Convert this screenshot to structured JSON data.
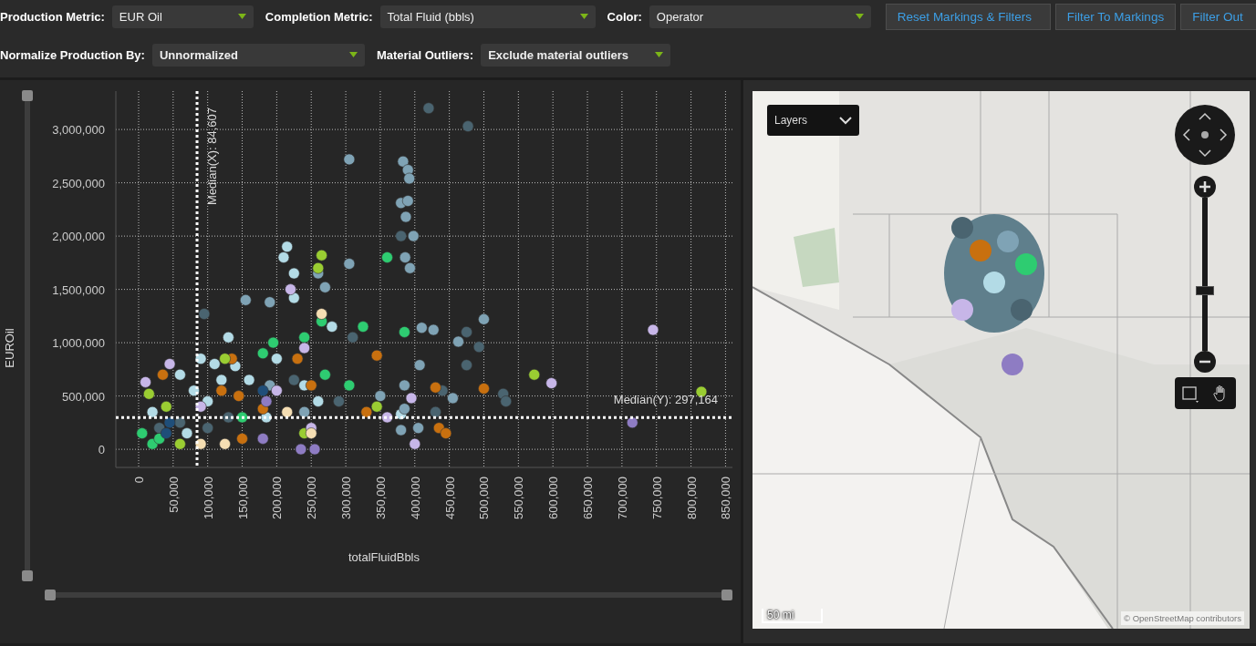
{
  "filter_row_1": [
    {
      "label": "Production Metric:",
      "value": "EUR Oil",
      "bold": false
    },
    {
      "label": "Completion Metric:",
      "value": "Total Fluid (bbls)",
      "bold": false
    },
    {
      "label": "Color:",
      "value": "Operator",
      "bold": false
    }
  ],
  "buttons": [
    "Reset Markings & Filters",
    "Filter To Markings",
    "Filter Out"
  ],
  "filter_row_2": [
    {
      "label": "Normalize Production By:",
      "value": "Unnormalized",
      "bold": true
    },
    {
      "label": "Material Outliers:",
      "value": "Exclude material outliers",
      "bold": true
    }
  ],
  "chart_panel": {
    "chart_data": {
      "type": "scatter",
      "xlabel": "totalFluidBbls",
      "ylabel": "EUROil",
      "grid": true,
      "xlim": [
        -33000,
        860000
      ],
      "ylim": [
        -170000,
        3360000
      ],
      "xticks": [
        {
          "value": 0,
          "label": "0"
        },
        {
          "value": 50000,
          "label": "50,000"
        },
        {
          "value": 100000,
          "label": "100,000"
        },
        {
          "value": 150000,
          "label": "150,000"
        },
        {
          "value": 200000,
          "label": "200,000"
        },
        {
          "value": 250000,
          "label": "250,000"
        },
        {
          "value": 300000,
          "label": "300,000"
        },
        {
          "value": 350000,
          "label": "350,000"
        },
        {
          "value": 400000,
          "label": "400,000"
        },
        {
          "value": 450000,
          "label": "450,000"
        },
        {
          "value": 500000,
          "label": "500,000"
        },
        {
          "value": 550000,
          "label": "550,000"
        },
        {
          "value": 600000,
          "label": "600,000"
        },
        {
          "value": 650000,
          "label": "650,000"
        },
        {
          "value": 700000,
          "label": "700,000"
        },
        {
          "value": 750000,
          "label": "750,000"
        },
        {
          "value": 800000,
          "label": "800,000"
        },
        {
          "value": 850000,
          "label": "850,000"
        }
      ],
      "yticks": [
        {
          "value": 0,
          "label": "0"
        },
        {
          "value": 500000,
          "label": "500,000"
        },
        {
          "value": 1000000,
          "label": "1,000,000"
        },
        {
          "value": 1500000,
          "label": "1,500,000"
        },
        {
          "value": 2000000,
          "label": "2,000,000"
        },
        {
          "value": 2500000,
          "label": "2,500,000"
        },
        {
          "value": 3000000,
          "label": "3,000,000"
        }
      ],
      "series": [
        {
          "color": "#b3dbe6",
          "x": [
            20000,
            60000,
            90000,
            110000,
            130000,
            210000,
            215000,
            225000,
            225000,
            240000,
            280000,
            100000,
            160000,
            185000,
            380000,
            260000,
            70000,
            120000,
            140000,
            80000,
            200000
          ],
          "values": [
            350000,
            700000,
            850000,
            800000,
            1050000,
            1800000,
            1900000,
            1650000,
            1420000,
            600000,
            1150000,
            450000,
            650000,
            300000,
            330000,
            450000,
            150000,
            650000,
            780000,
            550000,
            850000
          ]
        },
        {
          "color": "#7fa3b5",
          "x": [
            155000,
            190000,
            260000,
            270000,
            305000,
            305000,
            383000,
            390000,
            392000,
            380000,
            390000,
            387000,
            398000,
            386000,
            393000,
            410000,
            427000,
            500000,
            463000,
            407000,
            385000,
            455000,
            350000,
            385000,
            405000,
            380000,
            190000,
            240000
          ],
          "values": [
            1400000,
            1380000,
            1650000,
            1520000,
            2720000,
            1740000,
            2700000,
            2620000,
            2540000,
            2310000,
            2330000,
            2180000,
            2000000,
            1800000,
            1700000,
            1140000,
            1120000,
            1220000,
            1010000,
            790000,
            600000,
            480000,
            500000,
            380000,
            200000,
            180000,
            600000,
            350000
          ]
        },
        {
          "color": "#4a6470",
          "x": [
            95000,
            420000,
            477000,
            380000,
            310000,
            475000,
            493000,
            440000,
            475000,
            528000,
            532000,
            430000,
            60000,
            130000,
            30000,
            225000,
            290000,
            100000
          ],
          "values": [
            1270000,
            3200000,
            3030000,
            2000000,
            1050000,
            1100000,
            960000,
            550000,
            790000,
            520000,
            450000,
            350000,
            250000,
            300000,
            200000,
            650000,
            450000,
            200000
          ]
        },
        {
          "color": "#2ecc71",
          "x": [
            5000,
            20000,
            180000,
            195000,
            240000,
            265000,
            305000,
            325000,
            385000,
            360000,
            270000,
            150000,
            30000
          ],
          "values": [
            150000,
            50000,
            900000,
            1000000,
            1050000,
            1200000,
            600000,
            1150000,
            1100000,
            1800000,
            700000,
            300000,
            100000
          ]
        },
        {
          "color": "#c8700f",
          "x": [
            35000,
            135000,
            145000,
            230000,
            250000,
            330000,
            345000,
            500000,
            430000,
            435000,
            445000,
            120000,
            180000,
            150000
          ],
          "values": [
            700000,
            850000,
            500000,
            850000,
            600000,
            350000,
            880000,
            570000,
            580000,
            200000,
            150000,
            550000,
            380000,
            100000
          ]
        },
        {
          "color": "#9acd32",
          "x": [
            15000,
            40000,
            265000,
            260000,
            345000,
            573000,
            815000,
            125000,
            60000,
            240000
          ],
          "values": [
            520000,
            400000,
            1820000,
            1700000,
            400000,
            700000,
            540000,
            850000,
            50000,
            150000
          ]
        },
        {
          "color": "#c7b6e8",
          "x": [
            10000,
            45000,
            220000,
            240000,
            395000,
            598000,
            745000,
            360000,
            400000,
            90000,
            200000,
            250000
          ],
          "values": [
            630000,
            800000,
            1500000,
            950000,
            480000,
            620000,
            1120000,
            300000,
            50000,
            400000,
            550000,
            200000
          ]
        },
        {
          "color": "#8e7cc3",
          "x": [
            185000,
            235000,
            255000,
            715000,
            180000
          ],
          "values": [
            450000,
            0,
            0,
            250000,
            100000
          ]
        },
        {
          "color": "#f5deb3",
          "x": [
            265000,
            90000,
            125000,
            250000,
            215000
          ],
          "values": [
            1270000,
            50000,
            50000,
            150000,
            350000
          ]
        },
        {
          "color": "#1f4e79",
          "x": [
            45000,
            180000,
            40000
          ],
          "values": [
            250000,
            550000,
            150000
          ]
        }
      ],
      "ref_lines": [
        {
          "axis": "x",
          "value": 84607,
          "label": "Median(X): 84,607"
        },
        {
          "axis": "y",
          "value": 297164,
          "label": "Median(Y): 297,164"
        }
      ]
    }
  },
  "map_panel": {
    "kind": "picture",
    "layers_button": "Layers",
    "zoom": {
      "level": 0.39
    },
    "scale_label": "50 mi",
    "attribution": "© OpenStreetMap contributors"
  }
}
